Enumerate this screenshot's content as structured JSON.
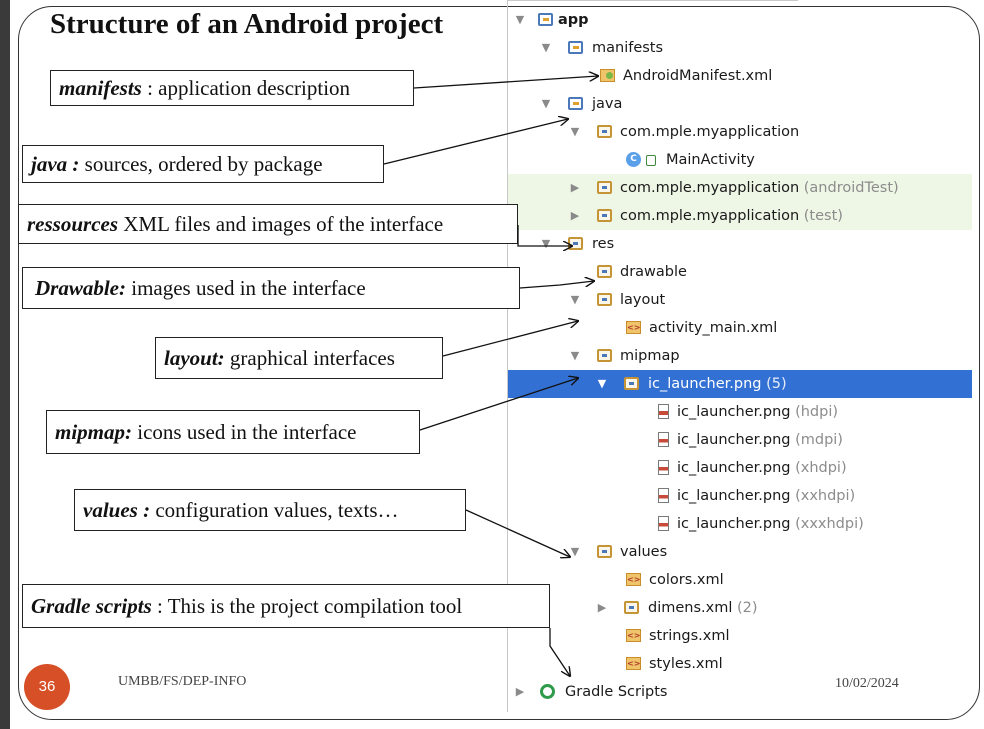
{
  "slide": {
    "title": "Structure of an Android project",
    "page_number": "36",
    "footer_left": "UMBB/FS/DEP-INFO",
    "footer_right": "10/02/2024"
  },
  "annotations": [
    {
      "term": "manifests",
      "text": " : application description"
    },
    {
      "term": "java :",
      "text": " sources, ordered by package"
    },
    {
      "term": "ressources",
      "text": " XML files and images of the interface"
    },
    {
      "term": "Drawable:",
      "text": " images used in the interface"
    },
    {
      "term": "layout:",
      "text": " graphical interfaces"
    },
    {
      "term": "mipmap:",
      "text": " icons used in the interface"
    },
    {
      "term": "values :",
      "text": " configuration values, texts…"
    },
    {
      "term": "Gradle scripts",
      "text": " : This is the project compilation tool"
    }
  ],
  "tree": {
    "rows": [
      {
        "label": "app",
        "suffix": ""
      },
      {
        "label": "manifests",
        "suffix": ""
      },
      {
        "label": "AndroidManifest.xml",
        "suffix": ""
      },
      {
        "label": "java",
        "suffix": ""
      },
      {
        "label": "com.mple.myapplication",
        "suffix": ""
      },
      {
        "label": "MainActivity",
        "suffix": ""
      },
      {
        "label": "com.mple.myapplication",
        "suffix": " (androidTest)"
      },
      {
        "label": "com.mple.myapplication",
        "suffix": " (test)"
      },
      {
        "label": "res",
        "suffix": ""
      },
      {
        "label": "drawable",
        "suffix": ""
      },
      {
        "label": "layout",
        "suffix": ""
      },
      {
        "label": "activity_main.xml",
        "suffix": ""
      },
      {
        "label": "mipmap",
        "suffix": ""
      },
      {
        "label": "ic_launcher.png",
        "suffix": " (5)"
      },
      {
        "label": "ic_launcher.png",
        "suffix": " (hdpi)"
      },
      {
        "label": "ic_launcher.png",
        "suffix": " (mdpi)"
      },
      {
        "label": "ic_launcher.png",
        "suffix": " (xhdpi)"
      },
      {
        "label": "ic_launcher.png",
        "suffix": " (xxhdpi)"
      },
      {
        "label": "ic_launcher.png",
        "suffix": " (xxxhdpi)"
      },
      {
        "label": "values",
        "suffix": ""
      },
      {
        "label": "colors.xml",
        "suffix": ""
      },
      {
        "label": "dimens.xml",
        "suffix": " (2)"
      },
      {
        "label": "strings.xml",
        "suffix": ""
      },
      {
        "label": "styles.xml",
        "suffix": ""
      },
      {
        "label": "Gradle Scripts",
        "suffix": ""
      }
    ],
    "selected_row": "ic_launcher.png (5)"
  },
  "icons": {
    "expanded": "triangle-down-icon",
    "collapsed": "triangle-right-icon",
    "folder": "folder-icon",
    "package": "package-folder-icon",
    "xml": "xml-file-icon",
    "image": "image-file-icon",
    "class": "class-icon",
    "gradle": "gradle-icon"
  },
  "colors": {
    "selection": "#3370d4",
    "test_highlight": "#eef7e6",
    "page_badge": "#d64f27"
  }
}
